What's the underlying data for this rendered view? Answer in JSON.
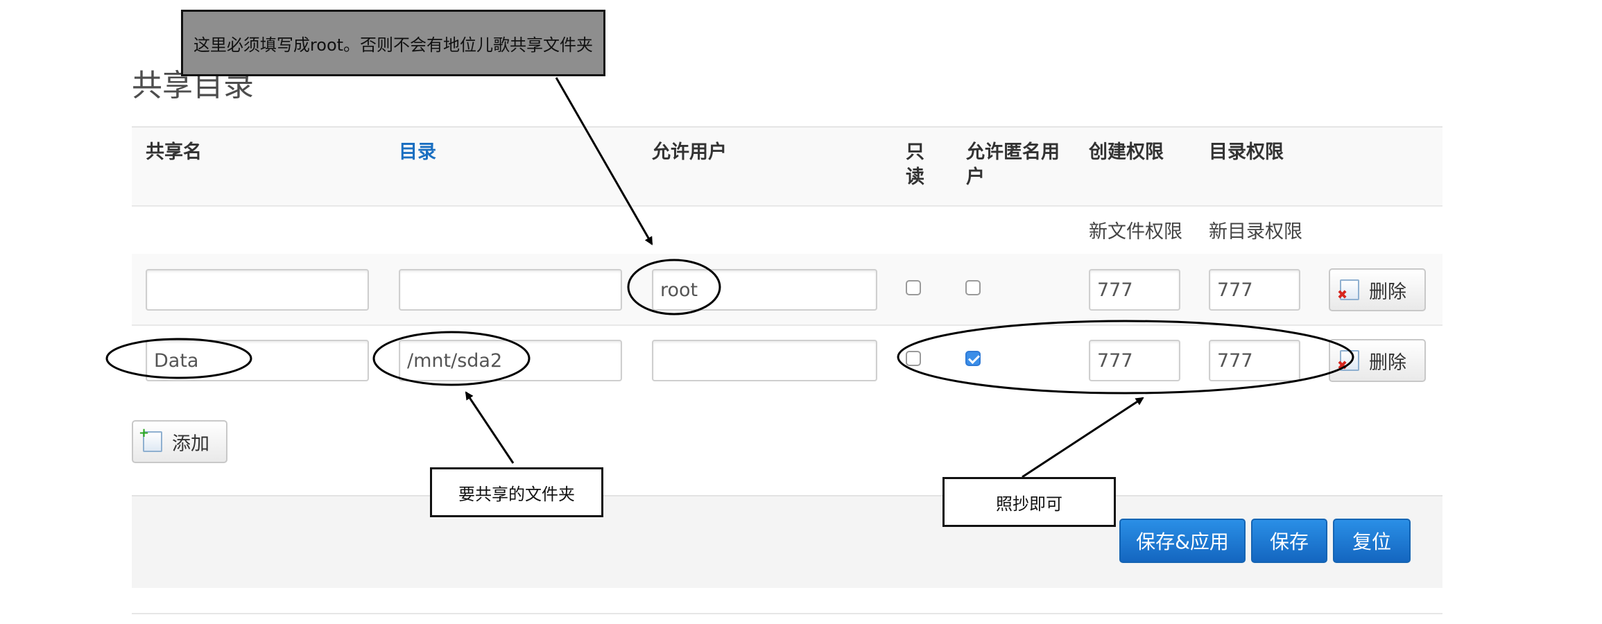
{
  "page": {
    "title": "共享目录"
  },
  "table": {
    "headers": {
      "name": "共享名",
      "path": "目录",
      "users": "允许用户",
      "readonly": "只读",
      "guest": "允许匿名用户",
      "create_mask": "创建权限",
      "dir_mask": "目录权限"
    },
    "subheaders": {
      "create_mask": "新文件权限",
      "dir_mask": "新目录权限"
    },
    "rows": [
      {
        "name": "",
        "path": "",
        "users": "root",
        "readonly": false,
        "guest": false,
        "create_mask": "777",
        "dir_mask": "777",
        "delete_label": "删除"
      },
      {
        "name": "Data",
        "path": "/mnt/sda2",
        "users": "",
        "readonly": false,
        "guest": true,
        "create_mask": "777",
        "dir_mask": "777",
        "delete_label": "删除"
      }
    ]
  },
  "add_label": "添加",
  "footer": {
    "save_apply": "保存&应用",
    "save": "保存",
    "reset": "复位"
  },
  "annotations": {
    "root_note": "这里必须填写成root。否则不会有地位儿歌共享文件夹",
    "folder_note": "要共享的文件夹",
    "copy_note": "照抄即可"
  },
  "colors": {
    "primary": "#1a7bd4",
    "link": "#1a6fc1",
    "checkbox_on": "#3b8ee8",
    "delete_icon": "#d7261e",
    "add_icon": "#2aa81f"
  },
  "icons": {
    "delete": "delete-doc-icon",
    "add": "add-doc-icon"
  }
}
